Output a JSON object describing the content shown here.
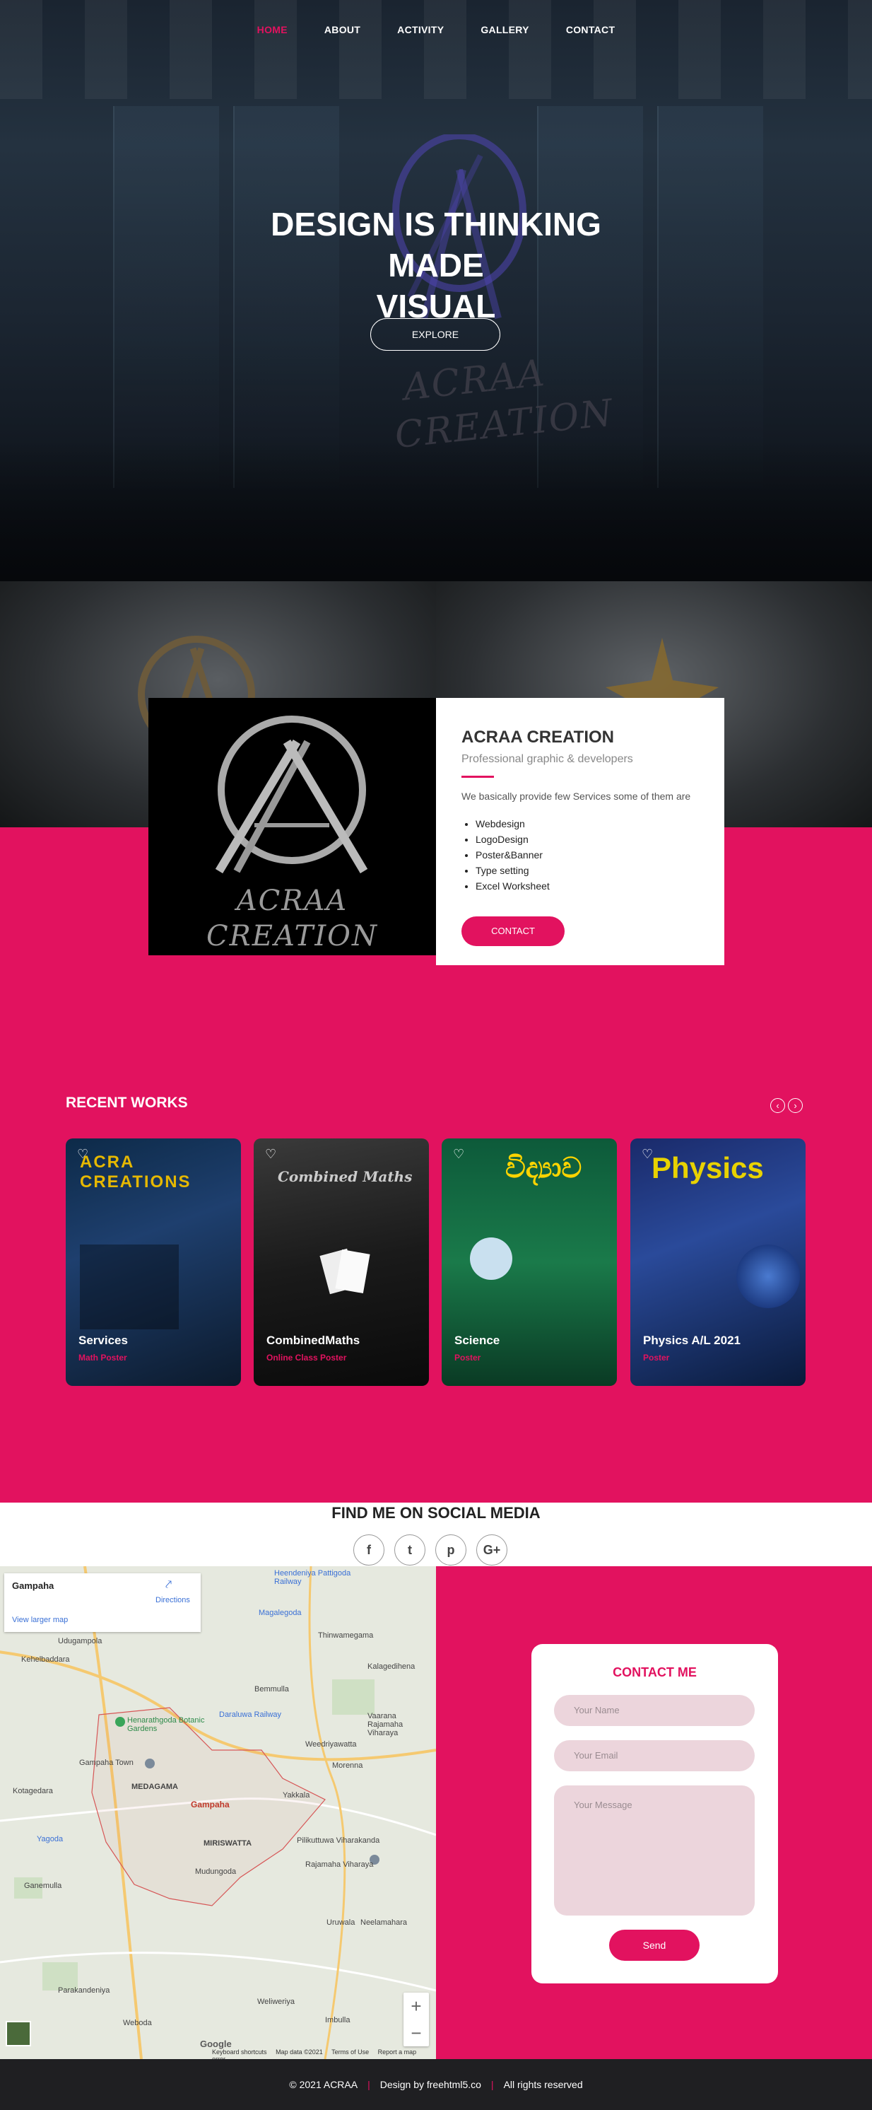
{
  "nav": {
    "items": [
      {
        "label": "HOME",
        "active": true
      },
      {
        "label": "ABOUT",
        "active": false
      },
      {
        "label": "ACTIVITY",
        "active": false
      },
      {
        "label": "GALLERY",
        "active": false
      },
      {
        "label": "CONTACT",
        "active": false
      }
    ]
  },
  "hero": {
    "title_line1": "DESIGN IS THINKING MADE",
    "title_line2": "VISUAL",
    "explore_label": "EXPLORE",
    "watermark_line1": "ACRAA",
    "watermark_line2": "CREATION"
  },
  "about": {
    "logo_line1": "ACRAA",
    "logo_line2": "CREATION",
    "title": "ACRAA CREATION",
    "subtitle": "Professional graphic & developers",
    "intro": "We basically provide few Services some of them are",
    "services": [
      "Webdesign",
      "LogoDesign",
      "Poster&Banner",
      "Type setting",
      "Excel Worksheet"
    ],
    "contact_label": "CONTACT"
  },
  "works": {
    "title": "RECENT WORKS",
    "prev_icon": "chevron-left-icon",
    "next_icon": "chevron-right-icon",
    "cards": [
      {
        "title": "Services",
        "sub": "Math Poster",
        "poster_heading": "ACRA CREATIONS"
      },
      {
        "title": "CombinedMaths",
        "sub": "Online Class Poster",
        "poster_heading": "Combined Maths"
      },
      {
        "title": "Science",
        "sub": "Poster",
        "poster_heading": "විද්‍යාව"
      },
      {
        "title": "Physics A/L 2021",
        "sub": "Poster",
        "poster_heading": "Physics"
      }
    ]
  },
  "social": {
    "title": "FIND ME ON SOCIAL MEDIA",
    "icons": [
      {
        "name": "facebook-icon",
        "glyph": "f"
      },
      {
        "name": "twitter-icon",
        "glyph": "t"
      },
      {
        "name": "pinterest-icon",
        "glyph": "p"
      },
      {
        "name": "google-plus-icon",
        "glyph": "G+"
      }
    ]
  },
  "map": {
    "place": "Gampaha",
    "directions": "Directions",
    "larger_map": "View larger map",
    "google": "Google",
    "footer": [
      "Keyboard shortcuts",
      "Map data ©2021",
      "Terms of Use",
      "Report a map error"
    ],
    "labels": [
      "Udugampola",
      "Kehelbaddara",
      "Bemmulla",
      "Thinwamegama",
      "Kalagedihena",
      "Weedriyawatta",
      "Gampaha Town",
      "MEDAGAMA",
      "Gampaha",
      "Yakkala",
      "Morenna",
      "Kotagedara",
      "Yagoda",
      "MIRISWATTA",
      "Mudungoda",
      "Pilikuttuwa Viharakanda",
      "Uruwala",
      "Neelamahara",
      "Ganemulla",
      "Parakandeniya",
      "Weboda",
      "Imbulla",
      "Weliweriya",
      "Henarathgoda Botanic Gardens",
      "Daraluwa Railway",
      "Magalegoda",
      "Heendeniya Pattigoda Railway",
      "Vaarana Rajamaha Viharaya",
      "Rajamaha Viharaya"
    ],
    "zoom_in": "+",
    "zoom_out": "−"
  },
  "contact": {
    "title": "CONTACT ME",
    "name_placeholder": "Your Name",
    "email_placeholder": "Your Email",
    "message_placeholder": "Your Message",
    "send_label": "Send"
  },
  "footer": {
    "copyright": "© 2021 ACRAA",
    "credit": "Design by freehtml5.co",
    "rights": "All rights reserved"
  },
  "colors": {
    "accent": "#e2125f",
    "footer_bg": "#1f1f22"
  }
}
